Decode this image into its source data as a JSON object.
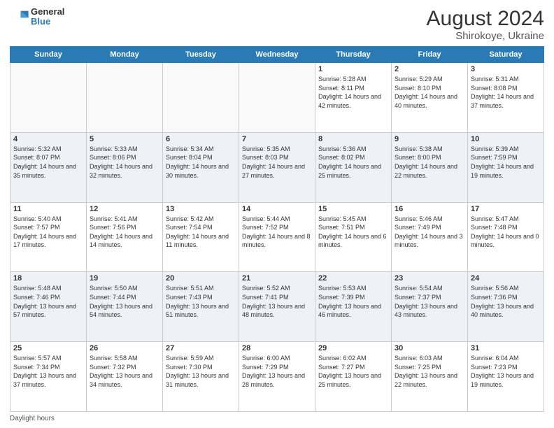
{
  "header": {
    "logo_general": "General",
    "logo_blue": "Blue",
    "title": "August 2024",
    "subtitle": "Shirokoye, Ukraine"
  },
  "days_of_week": [
    "Sunday",
    "Monday",
    "Tuesday",
    "Wednesday",
    "Thursday",
    "Friday",
    "Saturday"
  ],
  "footer": {
    "daylight_hours": "Daylight hours"
  },
  "weeks": [
    {
      "days": [
        {
          "num": "",
          "info": ""
        },
        {
          "num": "",
          "info": ""
        },
        {
          "num": "",
          "info": ""
        },
        {
          "num": "",
          "info": ""
        },
        {
          "num": "1",
          "info": "Sunrise: 5:28 AM\nSunset: 8:11 PM\nDaylight: 14 hours and 42 minutes."
        },
        {
          "num": "2",
          "info": "Sunrise: 5:29 AM\nSunset: 8:10 PM\nDaylight: 14 hours and 40 minutes."
        },
        {
          "num": "3",
          "info": "Sunrise: 5:31 AM\nSunset: 8:08 PM\nDaylight: 14 hours and 37 minutes."
        }
      ]
    },
    {
      "days": [
        {
          "num": "4",
          "info": "Sunrise: 5:32 AM\nSunset: 8:07 PM\nDaylight: 14 hours and 35 minutes."
        },
        {
          "num": "5",
          "info": "Sunrise: 5:33 AM\nSunset: 8:06 PM\nDaylight: 14 hours and 32 minutes."
        },
        {
          "num": "6",
          "info": "Sunrise: 5:34 AM\nSunset: 8:04 PM\nDaylight: 14 hours and 30 minutes."
        },
        {
          "num": "7",
          "info": "Sunrise: 5:35 AM\nSunset: 8:03 PM\nDaylight: 14 hours and 27 minutes."
        },
        {
          "num": "8",
          "info": "Sunrise: 5:36 AM\nSunset: 8:02 PM\nDaylight: 14 hours and 25 minutes."
        },
        {
          "num": "9",
          "info": "Sunrise: 5:38 AM\nSunset: 8:00 PM\nDaylight: 14 hours and 22 minutes."
        },
        {
          "num": "10",
          "info": "Sunrise: 5:39 AM\nSunset: 7:59 PM\nDaylight: 14 hours and 19 minutes."
        }
      ]
    },
    {
      "days": [
        {
          "num": "11",
          "info": "Sunrise: 5:40 AM\nSunset: 7:57 PM\nDaylight: 14 hours and 17 minutes."
        },
        {
          "num": "12",
          "info": "Sunrise: 5:41 AM\nSunset: 7:56 PM\nDaylight: 14 hours and 14 minutes."
        },
        {
          "num": "13",
          "info": "Sunrise: 5:42 AM\nSunset: 7:54 PM\nDaylight: 14 hours and 11 minutes."
        },
        {
          "num": "14",
          "info": "Sunrise: 5:44 AM\nSunset: 7:52 PM\nDaylight: 14 hours and 8 minutes."
        },
        {
          "num": "15",
          "info": "Sunrise: 5:45 AM\nSunset: 7:51 PM\nDaylight: 14 hours and 6 minutes."
        },
        {
          "num": "16",
          "info": "Sunrise: 5:46 AM\nSunset: 7:49 PM\nDaylight: 14 hours and 3 minutes."
        },
        {
          "num": "17",
          "info": "Sunrise: 5:47 AM\nSunset: 7:48 PM\nDaylight: 14 hours and 0 minutes."
        }
      ]
    },
    {
      "days": [
        {
          "num": "18",
          "info": "Sunrise: 5:48 AM\nSunset: 7:46 PM\nDaylight: 13 hours and 57 minutes."
        },
        {
          "num": "19",
          "info": "Sunrise: 5:50 AM\nSunset: 7:44 PM\nDaylight: 13 hours and 54 minutes."
        },
        {
          "num": "20",
          "info": "Sunrise: 5:51 AM\nSunset: 7:43 PM\nDaylight: 13 hours and 51 minutes."
        },
        {
          "num": "21",
          "info": "Sunrise: 5:52 AM\nSunset: 7:41 PM\nDaylight: 13 hours and 48 minutes."
        },
        {
          "num": "22",
          "info": "Sunrise: 5:53 AM\nSunset: 7:39 PM\nDaylight: 13 hours and 46 minutes."
        },
        {
          "num": "23",
          "info": "Sunrise: 5:54 AM\nSunset: 7:37 PM\nDaylight: 13 hours and 43 minutes."
        },
        {
          "num": "24",
          "info": "Sunrise: 5:56 AM\nSunset: 7:36 PM\nDaylight: 13 hours and 40 minutes."
        }
      ]
    },
    {
      "days": [
        {
          "num": "25",
          "info": "Sunrise: 5:57 AM\nSunset: 7:34 PM\nDaylight: 13 hours and 37 minutes."
        },
        {
          "num": "26",
          "info": "Sunrise: 5:58 AM\nSunset: 7:32 PM\nDaylight: 13 hours and 34 minutes."
        },
        {
          "num": "27",
          "info": "Sunrise: 5:59 AM\nSunset: 7:30 PM\nDaylight: 13 hours and 31 minutes."
        },
        {
          "num": "28",
          "info": "Sunrise: 6:00 AM\nSunset: 7:29 PM\nDaylight: 13 hours and 28 minutes."
        },
        {
          "num": "29",
          "info": "Sunrise: 6:02 AM\nSunset: 7:27 PM\nDaylight: 13 hours and 25 minutes."
        },
        {
          "num": "30",
          "info": "Sunrise: 6:03 AM\nSunset: 7:25 PM\nDaylight: 13 hours and 22 minutes."
        },
        {
          "num": "31",
          "info": "Sunrise: 6:04 AM\nSunset: 7:23 PM\nDaylight: 13 hours and 19 minutes."
        }
      ]
    }
  ]
}
